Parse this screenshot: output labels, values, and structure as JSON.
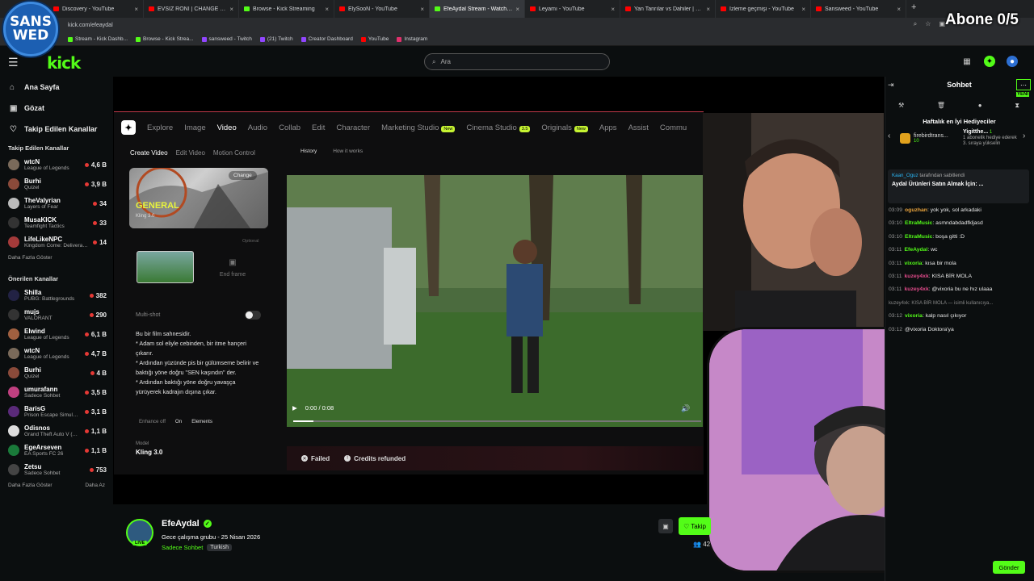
{
  "browser": {
    "tabs": [
      {
        "label": "Discovery - YouTube",
        "color": "#ff0000"
      },
      {
        "label": "EVSİZ RONI | CHANGE - YouTube",
        "color": "#ff0000"
      },
      {
        "label": "Browse - Kick Streaming",
        "color": "#53fc18"
      },
      {
        "label": "ElySooN - YouTube",
        "color": "#ff0000"
      },
      {
        "label": "EfeAydal Stream - Watch Live",
        "color": "#53fc18",
        "active": true
      },
      {
        "label": "Leyamı - YouTube",
        "color": "#ff0000"
      },
      {
        "label": "Yan Tanrılar vs Dahiler | Hangisi",
        "color": "#ff0000"
      },
      {
        "label": "İzleme geçmişi - YouTube",
        "color": "#ff0000"
      },
      {
        "label": "Sansweed - YouTube",
        "color": "#ff0000"
      }
    ],
    "new_tab": "+",
    "url": "kick.com/efeaydal",
    "bookmarks": [
      {
        "label": "Stream - Kick Dashb...",
        "color": "#53fc18"
      },
      {
        "label": "Browse - Kick Strea...",
        "color": "#53fc18"
      },
      {
        "label": "sansweed - Twitch",
        "color": "#9146ff"
      },
      {
        "label": "(21) Twitch",
        "color": "#9146ff"
      },
      {
        "label": "Creator Dashboard",
        "color": "#9146ff"
      },
      {
        "label": "YouTube",
        "color": "#ff0000"
      },
      {
        "label": "Instagram",
        "color": "#e1306c"
      }
    ]
  },
  "overlay": {
    "logo_line1": "SANS",
    "logo_line2": "WED",
    "abone": "Abone 0/5"
  },
  "header": {
    "search_placeholder": "Ara",
    "logo": "kick"
  },
  "sidebar": {
    "nav": [
      {
        "label": "Ana Sayfa",
        "icon": "home-icon"
      },
      {
        "label": "Gözat",
        "icon": "browse-icon"
      },
      {
        "label": "Takip Edilen Kanallar",
        "icon": "heart-icon"
      }
    ],
    "followed_title": "Takip Edilen Kanallar",
    "followed": [
      {
        "name": "wtcN",
        "game": "League of Legends",
        "viewers": "4,6 B",
        "color": "#7a6a5a"
      },
      {
        "name": "Burhi",
        "game": "Quizel",
        "viewers": "3,9 B",
        "color": "#8a4a3a"
      },
      {
        "name": "TheValyrian",
        "game": "Layers of Fear",
        "viewers": "34",
        "color": "#bbbbbb"
      },
      {
        "name": "MusaKICK",
        "game": "Teamfight Tactics",
        "viewers": "33",
        "color": "#333333"
      },
      {
        "name": "LifeLikeNPC",
        "game": "Kingdom Come: Deliverance II",
        "viewers": "14",
        "color": "#a43a3a"
      }
    ],
    "more1": "Daha Fazla Göster",
    "recommended_title": "Önerilen Kanallar",
    "recommended": [
      {
        "name": "Shilla",
        "game": "PUBG: Battlegrounds",
        "viewers": "382",
        "color": "#222244"
      },
      {
        "name": "mujs",
        "game": "VALORANT",
        "viewers": "290",
        "color": "#333333"
      },
      {
        "name": "Elwind",
        "game": "League of Legends",
        "viewers": "6,1 B",
        "color": "#a06040"
      },
      {
        "name": "wtcN",
        "game": "League of Legends",
        "viewers": "4,7 B",
        "color": "#7a6a5a"
      },
      {
        "name": "Burhi",
        "game": "Quizel",
        "viewers": "4 B",
        "color": "#8a4a3a"
      },
      {
        "name": "umurafann",
        "game": "Sadece Sohbet",
        "viewers": "3,5 B",
        "color": "#c04080"
      },
      {
        "name": "BarisG",
        "game": "Prison Escape Simulator",
        "viewers": "3,1 B",
        "color": "#5a2a7a"
      },
      {
        "name": "Odisnos",
        "game": "Grand Theft Auto V (GTA)",
        "viewers": "1,1 B",
        "color": "#dddddd"
      },
      {
        "name": "EgeArseven",
        "game": "EA Sports FC 26",
        "viewers": "1,1 B",
        "color": "#1a7a3a"
      },
      {
        "name": "Zetsu",
        "game": "Sadece Sohbet",
        "viewers": "753",
        "color": "#444444"
      }
    ],
    "more2": "Daha Fazla Göster",
    "less": "Daha Az"
  },
  "higgsfield": {
    "nav": [
      "Explore",
      "Image",
      "Video",
      "Audio",
      "Collab",
      "Edit",
      "Character",
      "Marketing Studio",
      "Cinema Studio",
      "Originals",
      "Apps",
      "Assist",
      "Commu"
    ],
    "badge_new": "New",
    "badge_cinema": "3.5",
    "tabs": [
      "Create Video",
      "Edit Video",
      "Motion Control"
    ],
    "history": "History",
    "how": "How it works",
    "general": "GENERAL",
    "kling_small": "Kling 3.0",
    "change": "Change",
    "optional": "Optional",
    "end_frame": "End frame",
    "multishot": "Multi-shot",
    "prompt": "Bu bir film sahnesidir.\n* Adam sol eliyle cebinden, bir itme hançeri çıkarır.\n* Ardından yüzünde pis bir gülümseme belirir ve baktığı yöne doğru \"SEN kaşındın\" der.\n* Ardından baktığı yöne doğru yavaşça yürüyerek kadrajın dışına çıkar.",
    "enhance": "Enhance off",
    "audio_on": "On",
    "elements": "Elements",
    "model_label": "Model",
    "model_value": "Kling 3.0",
    "time": "0:00 / 0:08",
    "progress": 0.05,
    "failed": "Failed",
    "refunded": "Credits refunded"
  },
  "channel": {
    "name": "EfeAydal",
    "title": "Gece çalışma grubu - 25 Nisan 2026",
    "category": "Sadece Sohbet",
    "language": "Turkish",
    "live": "LIVE",
    "follow": "Takip",
    "viewers": "42"
  },
  "chat": {
    "title": "Sohbet",
    "new_badge": "YENİ",
    "gifters_title": "Haftalık en İyi Hediyeciler",
    "gifter1_name": "firebirdtrans...",
    "gifter1_count": "10",
    "gifter2_name": "Yigitthe...",
    "gifter2_count": "1",
    "gifter2_desc": "1 abonelik hediye ederek 3. sıraya yükselin",
    "pinned_by": "Kaan_Oguz",
    "pinned_suffix": " tarafından sabitlendi",
    "pinned_text": "Aydal Ürünleri Satın Almak İçin: ...",
    "messages": [
      {
        "t": "03:09",
        "u": "oguzhan",
        "c": "#e8a33d",
        "m": ": yok yok, sol arkadaki"
      },
      {
        "t": "03:10",
        "u": "EltraMusic",
        "c": "#53fc18",
        "m": ": asmndabdadfkljasd"
      },
      {
        "t": "03:10",
        "u": "EltraMusic",
        "c": "#53fc18",
        "m": ": boşa gitti :D"
      },
      {
        "t": "03:11",
        "u": "EfeAydal",
        "c": "#53fc18",
        "m": ": wc"
      },
      {
        "t": "03:11",
        "u": "vixoria",
        "c": "#53fc18",
        "m": ": kısa bir mola"
      },
      {
        "t": "03:11",
        "u": "kuzey4xk",
        "c": "#e04a8a",
        "m": ": KISA BİR MOLA"
      },
      {
        "t": "03:11",
        "u": "kuzey4xk",
        "c": "#e04a8a",
        "m": ": @vixoria bu ne hız ulaaa"
      },
      {
        "t": "",
        "u": "",
        "c": "#888888",
        "m": "kuzey4xk: KISA BİR MOLA — isimli kullanıcıya...",
        "sys": true
      },
      {
        "t": "03:12",
        "u": "vixoria",
        "c": "#53fc18",
        "m": ": kalp nasıl çıkıyor"
      },
      {
        "t": "03:12",
        "u": "",
        "c": "#e04a8a",
        "m": "@vixoria Doktora'ya"
      }
    ],
    "send": "Gönder"
  }
}
